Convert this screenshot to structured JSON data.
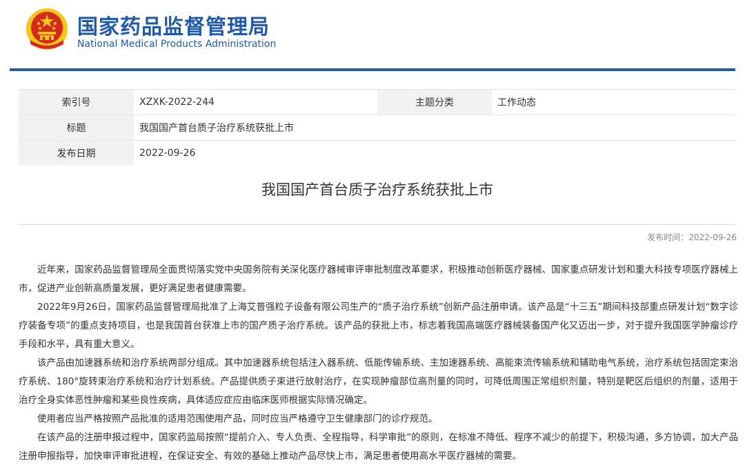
{
  "site": {
    "name_cn": "国家药品监督管理局",
    "name_en": "National Medical Products Administration",
    "colors": {
      "brand": "#1f5aa8",
      "emblem_red": "#d52b1e",
      "emblem_gold": "#f5c518"
    },
    "logo_icon": "national-emblem-icon"
  },
  "meta": {
    "index_label": "索引号",
    "index_value": "XZXK-2022-244",
    "topic_label": "主题分类",
    "topic_value": "工作动态",
    "title_label": "标题",
    "title_value": "我国国产首台质子治疗系统获批上市",
    "date_label": "发布日期",
    "date_value": "2022-09-26"
  },
  "article": {
    "title": "我国国产首台质子治疗系统获批上市",
    "publish_time": "发布时间：2022-09-26",
    "paragraphs": [
      "近年来，国家药品监督管理局全面贯彻落实党中央国务院有关深化医疗器械审评审批制度改革要求，积极推动创新医疗器械、国家重点研发计划和重大科技专项医疗器械上市，促进产业创新高质量发展，更好满足患者健康需要。",
      "2022年9月26日，国家药品监督管理局批准了上海艾普强粒子设备有限公司生产的“质子治疗系统”创新产品注册申请。该产品是“十三五”期间科技部重点研发计划“数字诊疗装备专项”的重点支持项目，也是我国首台获准上市的国产质子治疗系统。该产品的获批上市，标志着我国高端医疗器械装备国产化又迈出一步，对于提升我国医学肿瘤诊疗手段和水平，具有重大意义。",
      "该产品由加速器系统和治疗系统两部分组成。其中加速器系统包括注入器系统、低能传输系统、主加速器系统、高能束流传输系统和辅助电气系统，治疗系统包括固定束治疗系统、180°旋转束治疗系统和治疗计划系统。产品提供质子束进行放射治疗，在实现肿瘤部位高剂量的同时，可降低周围正常组织剂量，特别是靶区后组织的剂量，适用于治疗全身实体恶性肿瘤和某些良性疾病，具体适应症应由临床医师根据实际情况确定。",
      "使用者应当严格按照产品批准的适用范围使用产品，同时应当严格遵守卫生健康部门的诊疗规范。",
      "在该产品的注册申报过程中，国家药监局按照“提前介入、专人负责、全程指导，科学审批”的原则，在标准不降低、程序不减少的前提下，积极沟通，多方协调，加大产品注册申报指导，加快审评审批进程，在保证安全、有效的基础上推动产品尽快上市，满足患者使用高水平医疗器械的需要。"
    ]
  }
}
